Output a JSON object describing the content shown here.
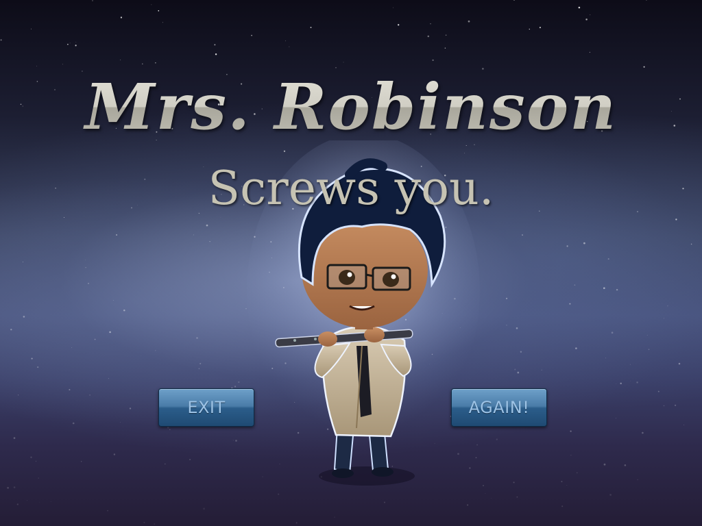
{
  "screen": {
    "title": "Mrs. Robinson",
    "subtitle": "Screws you."
  },
  "buttons": {
    "exit_label": "EXIT",
    "again_label": "AGAIN!"
  },
  "character": {
    "icon": "flute-player-character"
  },
  "colors": {
    "title": "#c9c7bc",
    "subtitle": "#c6c3b3",
    "button_top": "#6ea0c9",
    "button_bottom": "#1f4a73",
    "button_text": "#9dc3e6"
  }
}
